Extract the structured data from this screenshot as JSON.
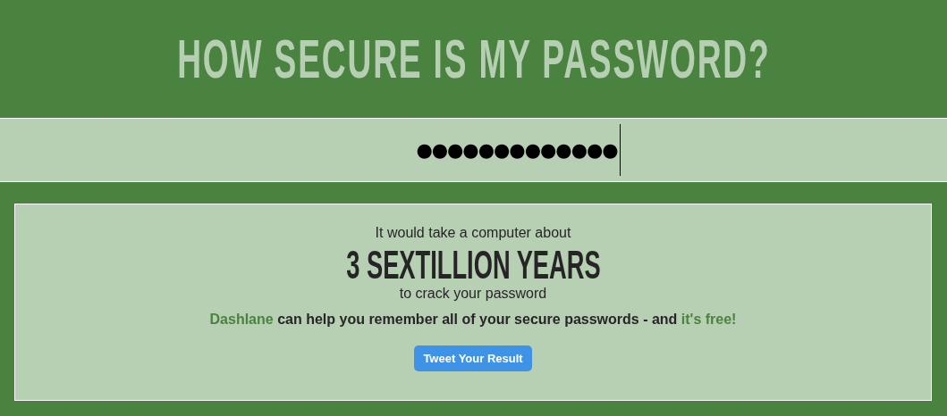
{
  "title": "HOW SECURE IS MY PASSWORD?",
  "password_field": {
    "value": "●●●●●●●●●●●●●"
  },
  "result": {
    "lead": "It would take a computer about",
    "time": "3 SEXTILLION YEARS",
    "tail": "to crack your password",
    "promo": [
      {
        "kind": "link",
        "text": "Dashlane"
      },
      {
        "kind": "text",
        "text": " can help you remember all of your secure passwords - and "
      },
      {
        "kind": "link",
        "text": "it's free!"
      }
    ],
    "button": "Tweet Your Result"
  }
}
